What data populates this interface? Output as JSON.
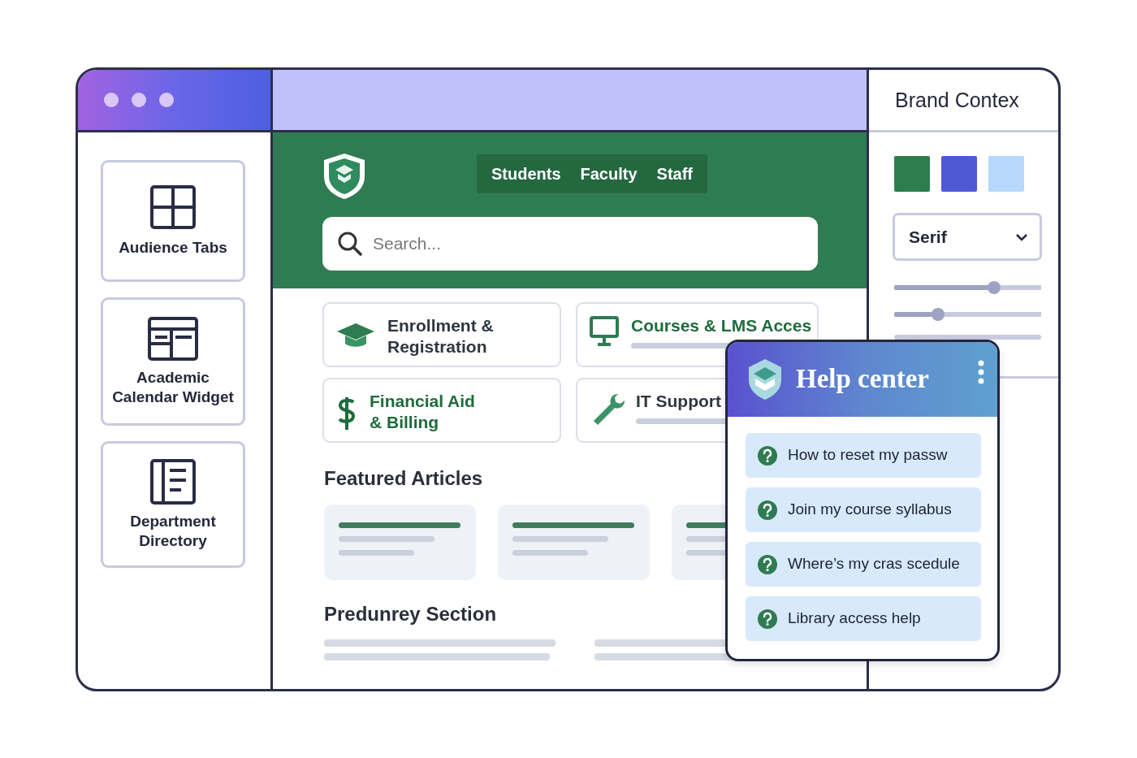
{
  "sidebar": {
    "items": [
      {
        "label": "Audience Tabs"
      },
      {
        "label": "Academic Calendar Widget"
      },
      {
        "label": "Department Directory"
      }
    ]
  },
  "header": {
    "tabs": [
      {
        "label": "Students"
      },
      {
        "label": "Faculty"
      },
      {
        "label": "Staff"
      }
    ],
    "search": {
      "placeholder": "Search..."
    }
  },
  "services": [
    {
      "label": "Enrollment & Registration",
      "color": "#2f3640"
    },
    {
      "label": "Courses & LMS Acces",
      "color": "#1f6b3c"
    },
    {
      "label": "Financial Aid & Billing",
      "color": "#1f6b3c"
    },
    {
      "label": "IT Support",
      "color": "#2f3640"
    }
  ],
  "featured": {
    "title": "Featured Articles"
  },
  "section": {
    "title": "Predunrey Section"
  },
  "brand": {
    "title": "Brand Contex",
    "swatches": [
      {
        "color": "#2e7d4f"
      },
      {
        "color": "#4f58d3"
      },
      {
        "color": "#b6d8fb"
      }
    ],
    "font": "Serif",
    "sliders": [
      {
        "level": 0.68
      },
      {
        "level": 0.3
      }
    ]
  },
  "help": {
    "title": "Help center",
    "questions": [
      "How to reset my passw",
      "Join my course syllabus",
      "Where’s my cras scedule",
      "Library access help"
    ]
  }
}
